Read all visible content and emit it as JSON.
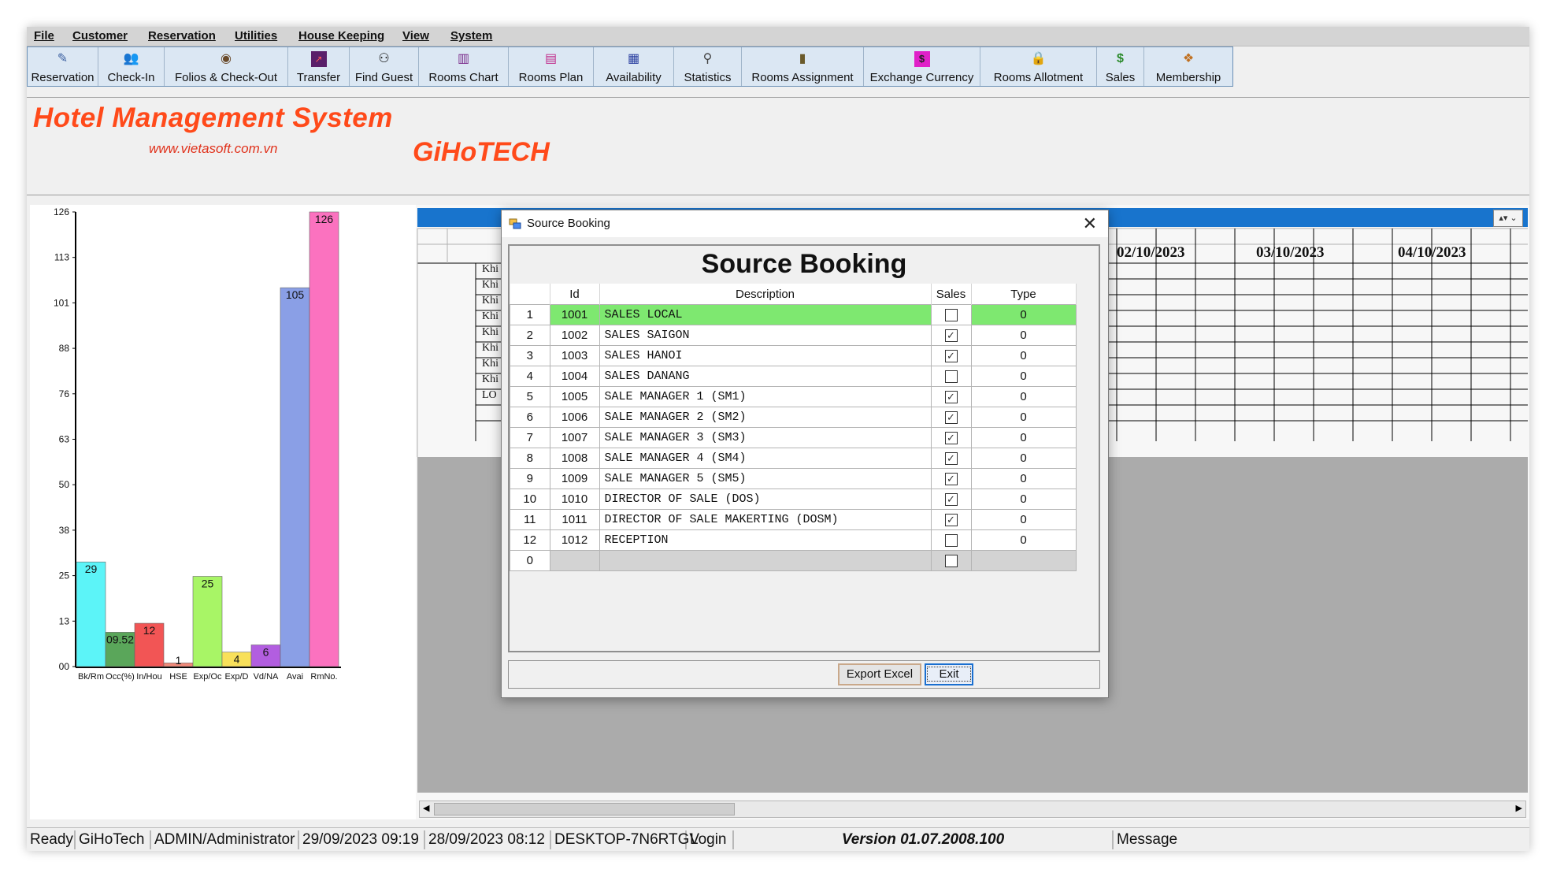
{
  "menu": [
    "File",
    "Customer",
    "Reservation",
    "Utilities",
    "House Keeping",
    "View",
    "System"
  ],
  "toolbar": [
    {
      "label": "Reservation",
      "icon": "pen-icon"
    },
    {
      "label": "Check-In",
      "icon": "people-icon"
    },
    {
      "label": "Folios & Check-Out",
      "icon": "globe-icon"
    },
    {
      "label": "Transfer",
      "icon": "chart-icon"
    },
    {
      "label": "Find Guest",
      "icon": "binoculars-icon"
    },
    {
      "label": "Rooms Chart",
      "icon": "bar-chart-icon"
    },
    {
      "label": "Rooms Plan",
      "icon": "rooms-plan-icon"
    },
    {
      "label": "Availability",
      "icon": "availability-icon"
    },
    {
      "label": "Statistics",
      "icon": "statistics-icon"
    },
    {
      "label": "Rooms Assignment",
      "icon": "assignment-icon"
    },
    {
      "label": "Exchange Currency",
      "icon": "currency-icon"
    },
    {
      "label": "Rooms Allotment",
      "icon": "lock-icon"
    },
    {
      "label": "Sales",
      "icon": "money-icon"
    },
    {
      "label": "Membership",
      "icon": "membership-icon"
    }
  ],
  "brand": {
    "title": "Hotel Management System",
    "url": "www.vietasoft.com.vn",
    "company": "GiHoTECH"
  },
  "chart_data": {
    "type": "bar",
    "categories": [
      "Bk/Rm",
      "Occ(%)",
      "In/Hou",
      "HSE",
      "Exp/Oc",
      "Exp/D",
      "Vd/NA",
      "Avai",
      "RmNo."
    ],
    "values": [
      29,
      9.52,
      12,
      1,
      25,
      4,
      6,
      105,
      126
    ],
    "value_labels": [
      "29",
      "09.52",
      "12",
      "1",
      "25",
      "4",
      "6",
      "105",
      "126"
    ],
    "colors": [
      "#5cf4f8",
      "#5aa65a",
      "#f25555",
      "#f08a7a",
      "#a8f566",
      "#f8e05a",
      "#b25ee0",
      "#8a9fe6",
      "#fb72bf"
    ],
    "yticks": [
      "00",
      "13",
      "25",
      "38",
      "50",
      "63",
      "76",
      "88",
      "101",
      "113",
      "126"
    ],
    "ylim": [
      0,
      126
    ]
  },
  "grid": {
    "dates": [
      "02/10/2023",
      "03/10/2023",
      "04/10/2023"
    ],
    "row_labels": [
      "Khi",
      "Khi",
      "Khi",
      "Khi",
      "Khi",
      "Khi",
      "Khi",
      "Khi",
      "LO"
    ]
  },
  "dialog": {
    "window_title": "Source Booking",
    "heading": "Source Booking",
    "columns": {
      "id": "Id",
      "description": "Description",
      "sales": "Sales",
      "type": "Type"
    },
    "rows": [
      {
        "rownum": "1",
        "id": "1001",
        "description": "SALES LOCAL",
        "sales": false,
        "type": "0",
        "selected": true
      },
      {
        "rownum": "2",
        "id": "1002",
        "description": "SALES SAIGON",
        "sales": true,
        "type": "0"
      },
      {
        "rownum": "3",
        "id": "1003",
        "description": "SALES HANOI",
        "sales": true,
        "type": "0"
      },
      {
        "rownum": "4",
        "id": "1004",
        "description": "SALES DANANG",
        "sales": false,
        "type": "0"
      },
      {
        "rownum": "5",
        "id": "1005",
        "description": "SALE MANAGER 1 (SM1)",
        "sales": true,
        "type": "0"
      },
      {
        "rownum": "6",
        "id": "1006",
        "description": "SALE MANAGER 2 (SM2)",
        "sales": true,
        "type": "0"
      },
      {
        "rownum": "7",
        "id": "1007",
        "description": "SALE MANAGER 3 (SM3)",
        "sales": true,
        "type": "0"
      },
      {
        "rownum": "8",
        "id": "1008",
        "description": "SALE MANAGER 4 (SM4)",
        "sales": true,
        "type": "0"
      },
      {
        "rownum": "9",
        "id": "1009",
        "description": "SALE MANAGER 5 (SM5)",
        "sales": true,
        "type": "0"
      },
      {
        "rownum": "10",
        "id": "1010",
        "description": "DIRECTOR OF SALE (DOS)",
        "sales": true,
        "type": "0"
      },
      {
        "rownum": "11",
        "id": "1011",
        "description": "DIRECTOR OF SALE MAKERTING (DOSM)",
        "sales": true,
        "type": "0"
      },
      {
        "rownum": "12",
        "id": "1012",
        "description": "RECEPTION",
        "sales": false,
        "type": "0"
      },
      {
        "rownum": "0",
        "id": "",
        "description": "",
        "sales": false,
        "type": "",
        "new_row": true
      }
    ],
    "export_label": "Export Excel",
    "exit_label": "Exit"
  },
  "status": [
    "Ready",
    "GiHoTech",
    "ADMIN/Administrator",
    "29/09/2023 09:19",
    "28/09/2023 08:12",
    "DESKTOP-7N6RTGV",
    "Login",
    "Version 01.07.2008.100",
    "Message"
  ]
}
